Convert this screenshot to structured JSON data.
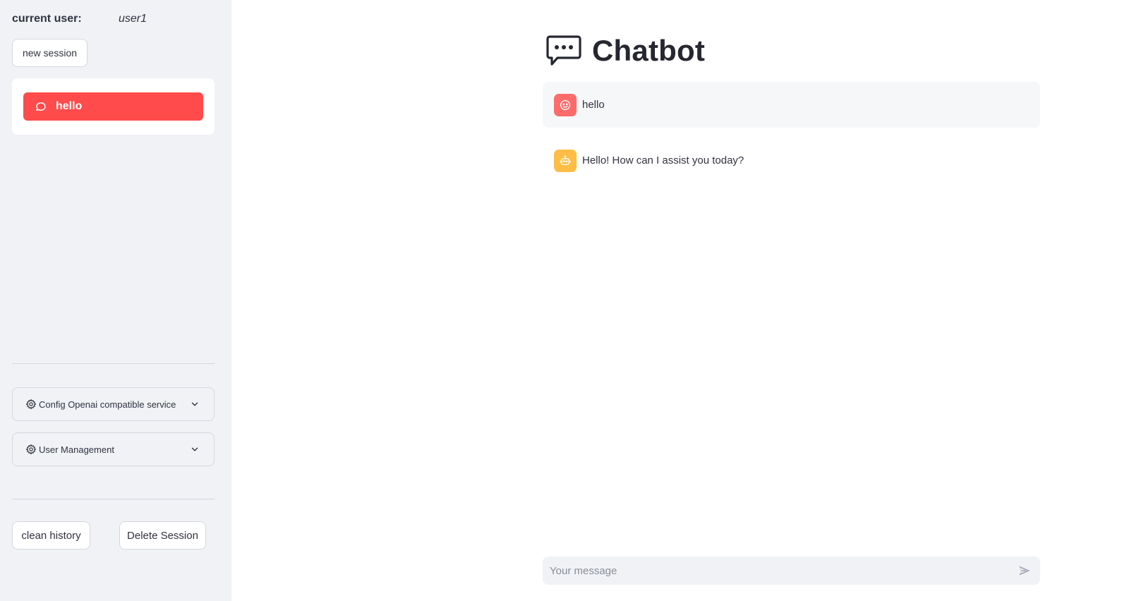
{
  "sidebar": {
    "current_user_label": "current user:",
    "current_user_name": "user1",
    "new_session_label": "new session",
    "sessions": [
      {
        "label": "hello",
        "icon": "chat-bubble-icon",
        "active": true
      }
    ],
    "expanders": [
      {
        "label": "Config Openai compatible service",
        "icon": "gear-icon"
      },
      {
        "label": "User Management",
        "icon": "gear-icon"
      }
    ],
    "clean_history_label": "clean history",
    "delete_session_label": "Delete Session"
  },
  "main": {
    "title": "Chatbot",
    "title_icon": "chat-dots-icon",
    "messages": [
      {
        "role": "user",
        "avatar_icon": "smiley-face-icon",
        "text": "hello"
      },
      {
        "role": "assistant",
        "avatar_icon": "robot-icon",
        "text": "Hello! How can I assist you today?"
      }
    ],
    "chat_input": {
      "placeholder": "Your message",
      "value": "",
      "send_icon": "send-arrow-icon"
    }
  },
  "colors": {
    "sidebar_bg": "#f0f2f6",
    "accent": "#ff4b4b",
    "user_avatar": "#ff6b6b",
    "assistant_avatar": "#ffbd45",
    "text": "#31333f"
  }
}
